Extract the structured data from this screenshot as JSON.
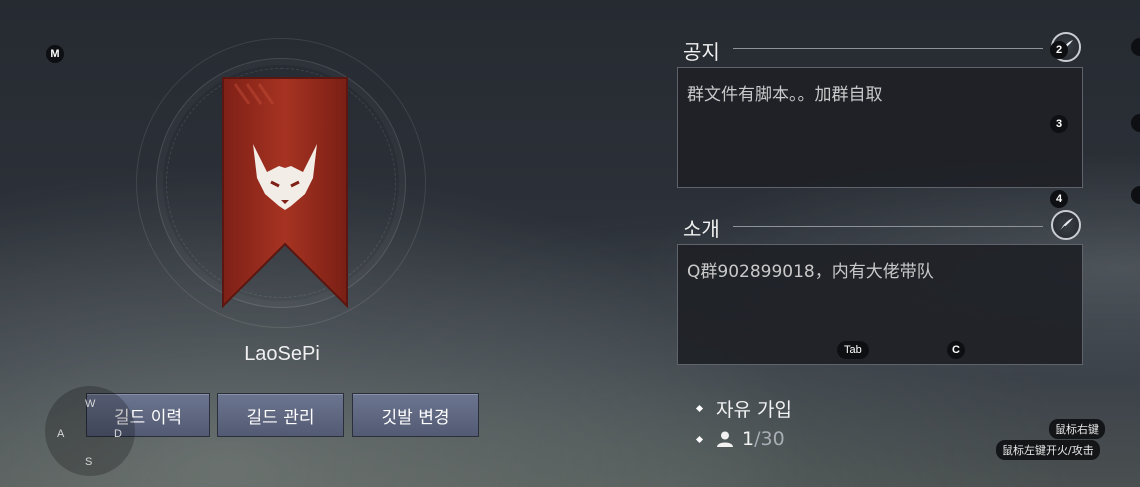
{
  "guild": {
    "name": "LaoSePi",
    "buttons": {
      "history": "길드 이력",
      "manage": "길드 관리",
      "banner": "깃발 변경"
    }
  },
  "notice": {
    "title": "공지",
    "text": "群文件有脚本。。加群自取"
  },
  "intro": {
    "title": "소개",
    "text": "Q群902899018，内有大佬带队"
  },
  "join_type": "자유 가입",
  "members": {
    "current": "1",
    "max": "/30"
  },
  "hints": {
    "m": "M",
    "k2": "2",
    "k3": "3",
    "k4": "4",
    "tab": "Tab",
    "c": "C",
    "w": "W",
    "a": "A",
    "s": "S",
    "d": "D",
    "mouse_right": "鼠标右键",
    "mouse_left": "鼠标左键开火/攻击"
  },
  "colors": {
    "banner": "#9c2b1e",
    "button": "#5f6782",
    "panel_bg": "#1e2126"
  }
}
